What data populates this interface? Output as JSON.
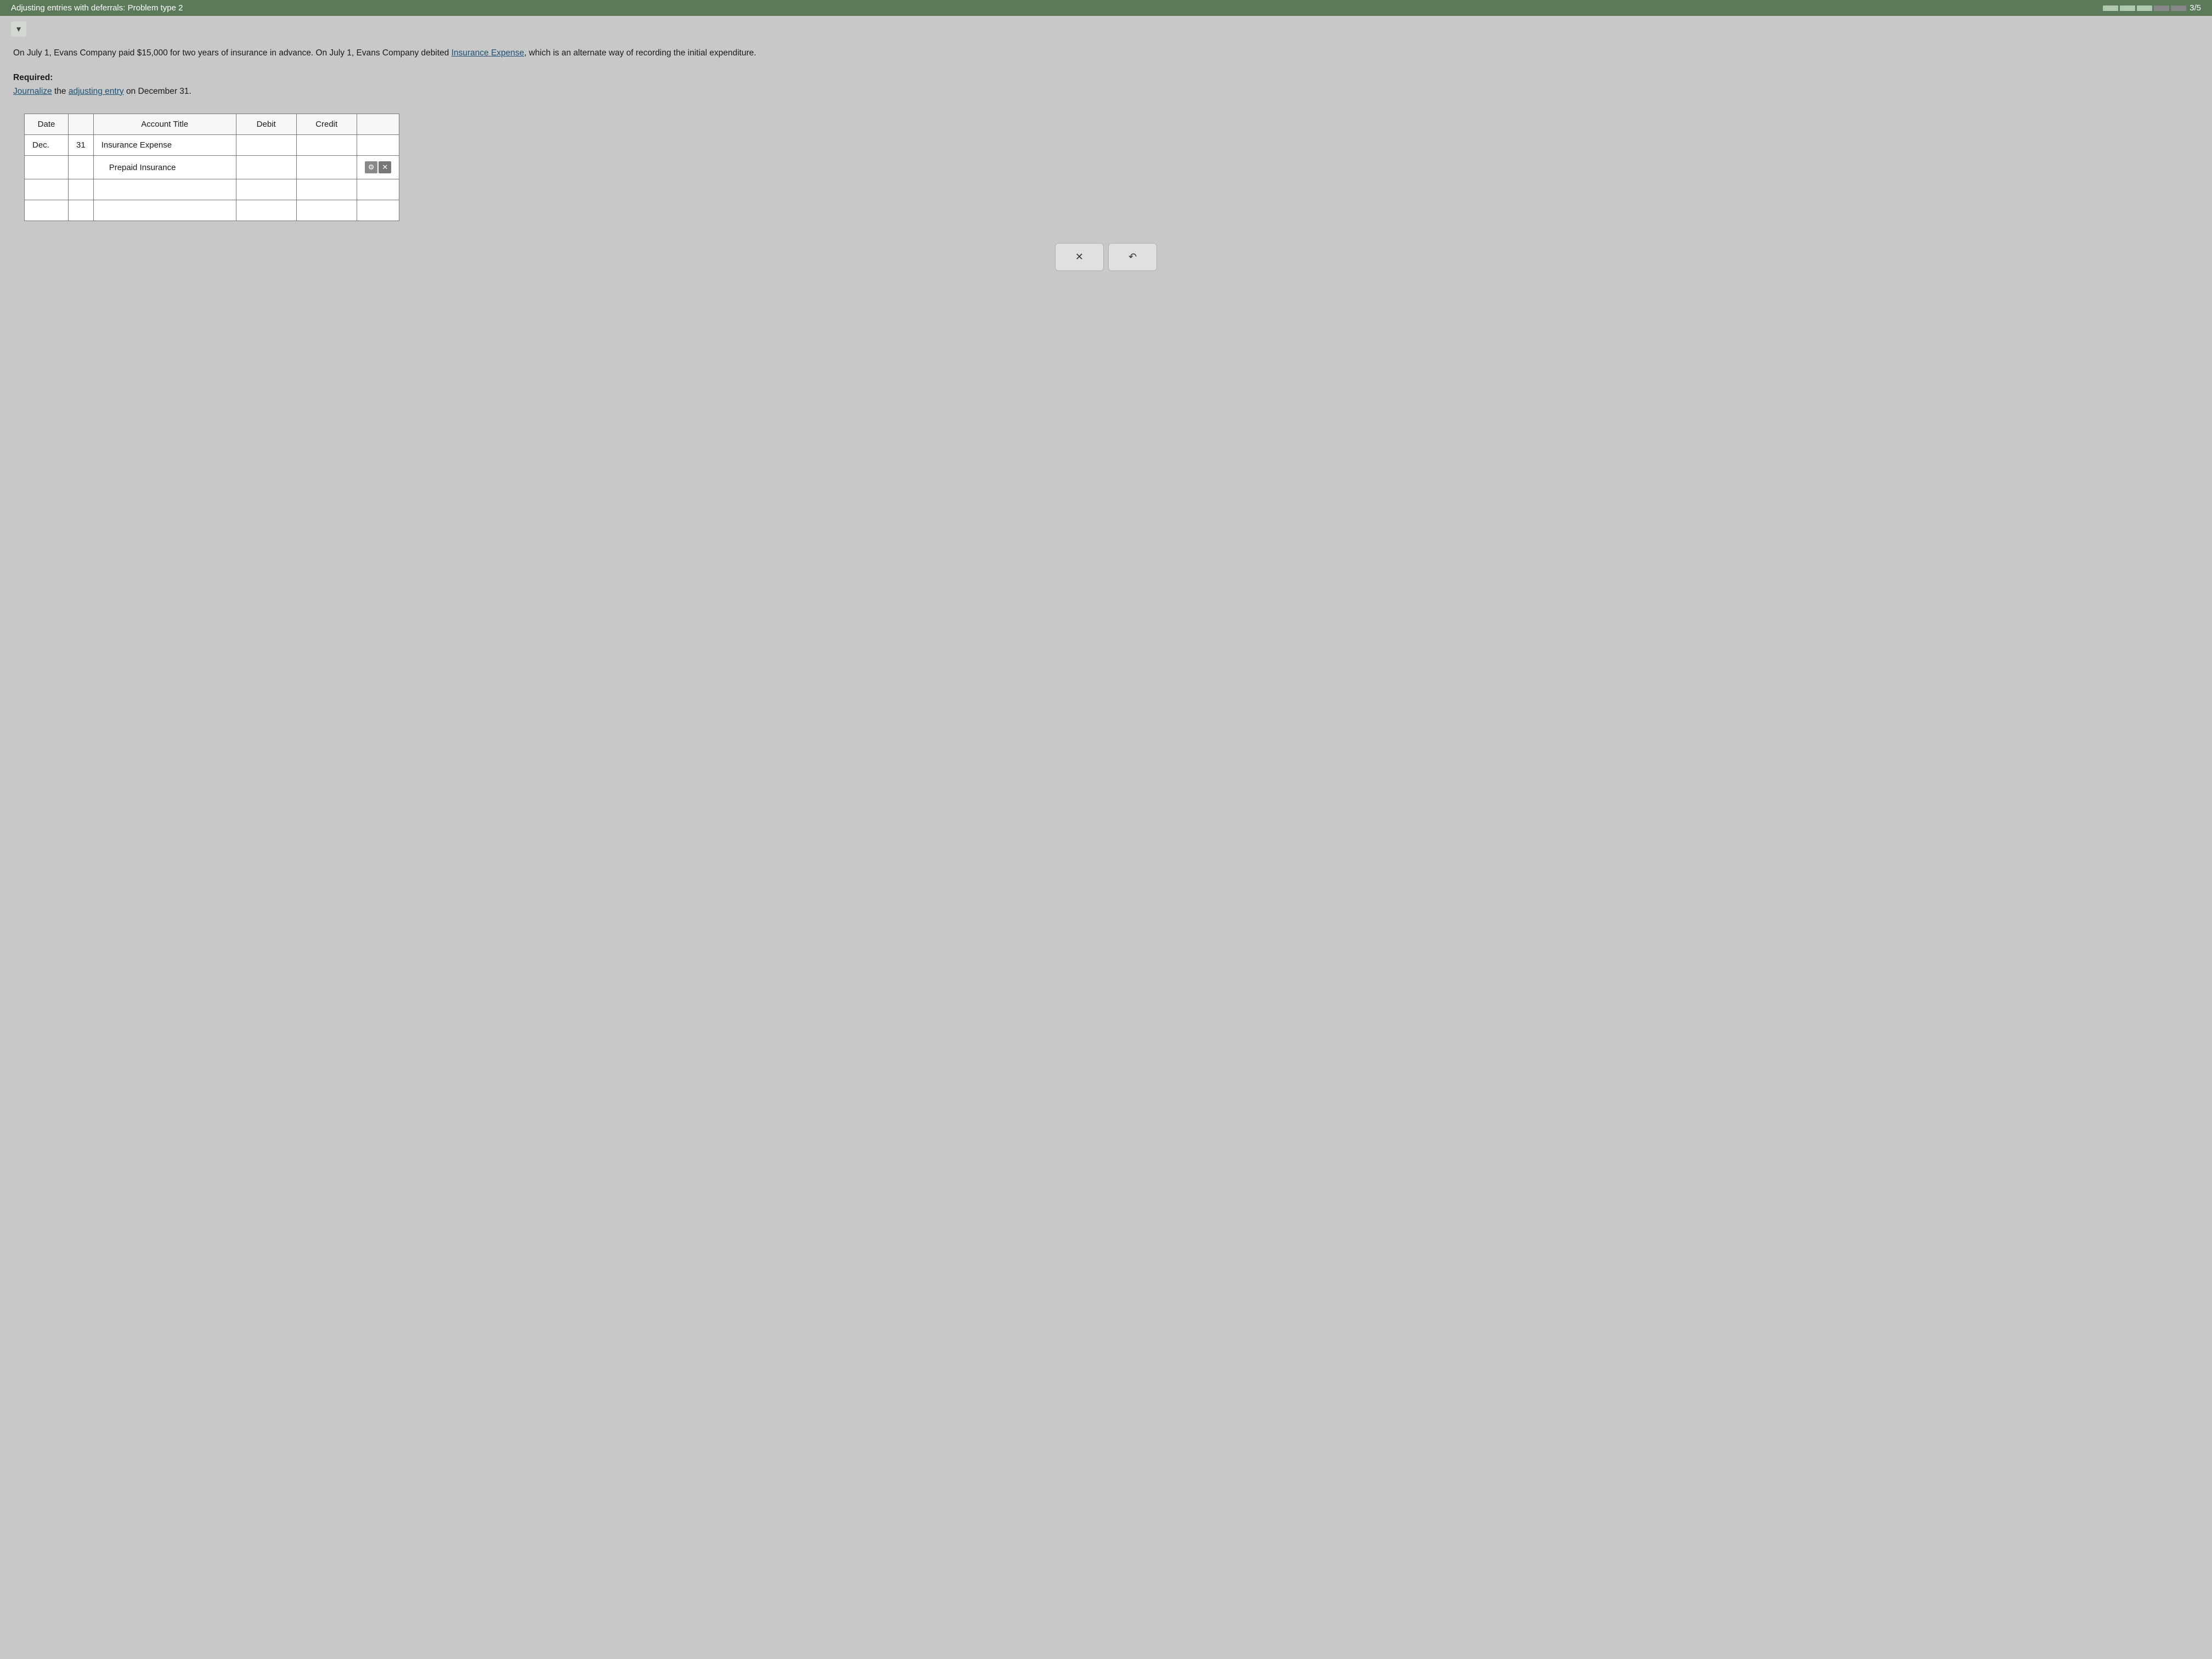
{
  "topbar": {
    "title": "Adjusting entries with deferrals: Problem type 2",
    "progress": "3/5"
  },
  "chevron": "▾",
  "problem_text_1": "On July 1, Evans Company paid $15,000 for two years of insurance in advance. On July 1, Evans Company debited Insurance",
  "problem_text_link": "Insurance Expense",
  "problem_text_2": "Expense, which is an alternate way of recording the initial expenditure.",
  "required_label": "Required:",
  "instruction_link": "Journalize",
  "instruction_text": " the ",
  "instruction_link2": "adjusting entry",
  "instruction_text2": " on December 31.",
  "table": {
    "headers": [
      "Date",
      "",
      "Account Title",
      "Debit",
      "Credit",
      ""
    ],
    "rows": [
      {
        "col1": "Dec.",
        "col2": "31",
        "col3": "Insurance Expense",
        "col4": "",
        "col5": "",
        "col6": "",
        "indent": false
      },
      {
        "col1": "",
        "col2": "",
        "col3": "Prepaid Insurance",
        "col4": "",
        "col5": "",
        "col6": "action",
        "indent": true
      },
      {
        "col1": "",
        "col2": "",
        "col3": "",
        "col4": "",
        "col5": "",
        "col6": "",
        "indent": false
      },
      {
        "col1": "",
        "col2": "",
        "col3": "",
        "col4": "",
        "col5": "",
        "col6": "",
        "indent": false
      }
    ]
  },
  "footer_buttons": {
    "clear": "✕",
    "undo": "↺"
  }
}
